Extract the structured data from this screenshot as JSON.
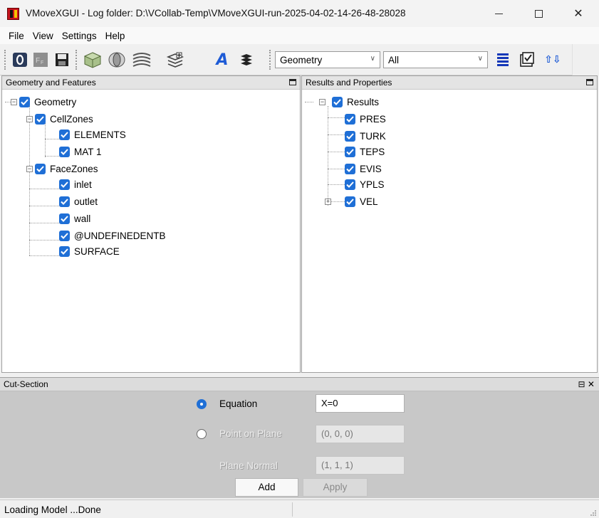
{
  "window": {
    "title": "VMoveXGUI - Log folder: D:\\VCollab-Temp\\VMoveXGUI-run-2025-04-02-14-26-48-28028",
    "minimize_label": "—",
    "close_label": "✕"
  },
  "menu": {
    "items": [
      "File",
      "View",
      "Settings",
      "Help"
    ]
  },
  "toolbar": {
    "buttons": [
      "open-model-icon",
      "features-icon",
      "save-icon",
      "geometry-icon",
      "cut-section-icon",
      "isosurface-icon",
      "layers-icon",
      "text-icon",
      "stack-icon",
      "list-icon",
      "checklist-icon",
      "transform-icon"
    ],
    "geometry_combo": "Geometry",
    "filter_combo": "All",
    "text_glyph": "A",
    "features_glyph": "F F",
    "open_glyph": "0",
    "transform_glyph": "⇧⇩"
  },
  "geometry_panel": {
    "header": "Geometry and Features",
    "root": "Geometry",
    "cellzones": "CellZones",
    "cellzone_items": [
      "ELEMENTS",
      "MAT 1"
    ],
    "facezones": "FaceZones",
    "facezone_items": [
      "inlet",
      "outlet",
      "wall",
      "@UNDEFINEDENTB",
      "SURFACE"
    ]
  },
  "results_panel": {
    "header": "Results and Properties",
    "root": "Results",
    "items": [
      "PRES",
      "TURK",
      "TEPS",
      "EVIS",
      "YPLS",
      "VEL"
    ]
  },
  "cut_section": {
    "header": "Cut-Section",
    "controls": "⊟ ✕",
    "equation_label": "Equation",
    "equation_value": "X=0",
    "point_label": "Point on Plane",
    "point_value": "(0, 0, 0)",
    "normal_label": "Plane Normal",
    "normal_value": "(1, 1, 1)",
    "add_label": "Add",
    "apply_label": "Apply"
  },
  "status": {
    "text": "Loading Model ...Done"
  },
  "colors": {
    "checkbox": "#1f6fd6",
    "brand": "#c8141e"
  }
}
